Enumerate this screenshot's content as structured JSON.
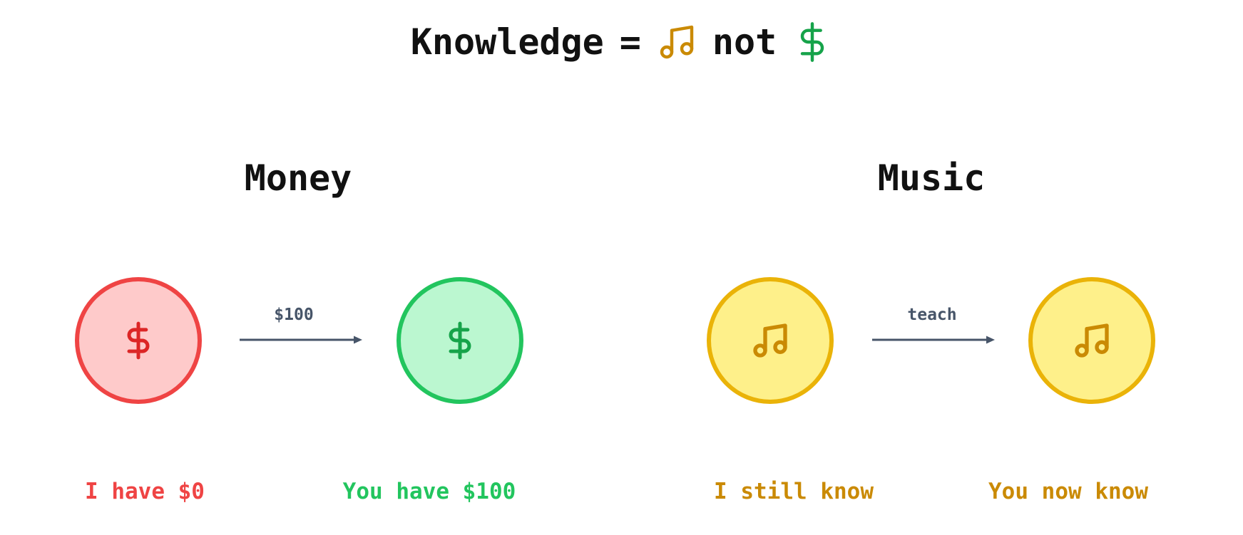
{
  "title": {
    "word": "Knowledge",
    "equals": "=",
    "connector": "not",
    "music_icon": "music-note-icon",
    "money_icon": "dollar-icon"
  },
  "sections": {
    "money": {
      "heading": "Money",
      "transfer_label": "$100",
      "from_caption": "I have $0",
      "to_caption": "You have $100"
    },
    "music": {
      "heading": "Music",
      "transfer_label": "teach",
      "from_caption": "I still know",
      "to_caption": "You now know"
    }
  },
  "colors": {
    "red_fill": "#fecaca",
    "red_stroke": "#ef4444",
    "red_icon": "#dc2626",
    "green_fill": "#bbf7d0",
    "green_stroke": "#22c55e",
    "green_icon": "#16a34a",
    "yellow_fill": "#fef08a",
    "yellow_stroke": "#eab308",
    "yellow_icon": "#ca8a04",
    "arrow": "#475569"
  }
}
